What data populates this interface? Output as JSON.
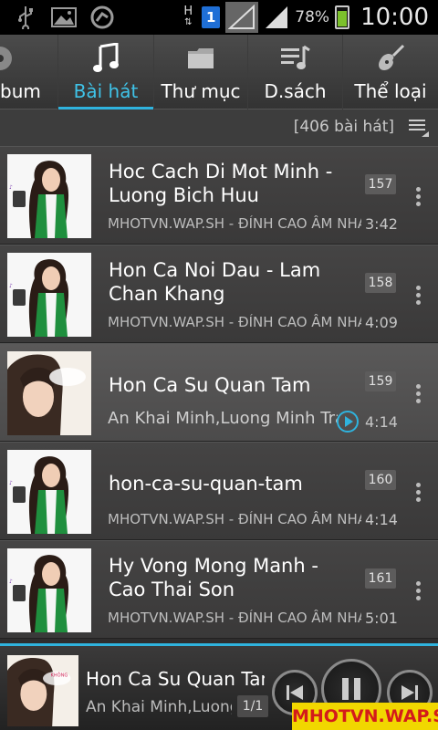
{
  "status_bar": {
    "icons": [
      "usb-icon",
      "image-icon",
      "sync-icon",
      "data-hplus-icon",
      "sim1-icon",
      "signal-icon",
      "signal-icon"
    ],
    "network": "H",
    "sim": "1",
    "battery": "78%",
    "battery_level": 0.78,
    "time": "10:00"
  },
  "tabs": [
    {
      "label": "bum",
      "icon": "album-icon",
      "active": false
    },
    {
      "label": "Bài hát",
      "icon": "music-note-icon",
      "active": true
    },
    {
      "label": "Thư mục",
      "icon": "folder-icon",
      "active": false
    },
    {
      "label": "D.sách",
      "icon": "playlist-icon",
      "active": false
    },
    {
      "label": "Thể loại",
      "icon": "guitar-icon",
      "active": false
    }
  ],
  "count_label": "[406 bài hát]",
  "songs": [
    {
      "title": "Hoc Cach Di Mot Minh - Luong Bich Huu",
      "subtitle": "MHOTVN.WAP.SH - ĐỈNH CAO ÂM NHẠC",
      "number": "157",
      "duration": "3:42",
      "playing": false
    },
    {
      "title": "Hon Ca Noi Dau - Lam Chan Khang",
      "subtitle": "MHOTVN.WAP.SH - ĐỈNH CAO ÂM NHẠC",
      "number": "158",
      "duration": "4:09",
      "playing": false
    },
    {
      "title": "Hon Ca Su Quan Tam",
      "subtitle": "An Khai Minh,Luong Minh Trang",
      "number": "159",
      "duration": "4:14",
      "playing": true
    },
    {
      "title": "hon-ca-su-quan-tam",
      "subtitle": "MHOTVN.WAP.SH - ĐỈNH CAO ÂM NHẠC",
      "number": "160",
      "duration": "4:14",
      "playing": false
    },
    {
      "title": "Hy Vong Mong Manh - Cao Thai Son",
      "subtitle": "MHOTVN.WAP.SH - ĐỈNH CAO ÂM NHẠC",
      "number": "161",
      "duration": "5:01",
      "playing": false
    }
  ],
  "now_playing": {
    "title": "Hon Ca Su Quan Tam",
    "artist": "An Khai Minh,Luong Minh Trang",
    "position": "1/1"
  },
  "watermark": "MHOTVN.WAP.SH",
  "colors": {
    "accent": "#2fb3de",
    "background": "#2a2929"
  }
}
